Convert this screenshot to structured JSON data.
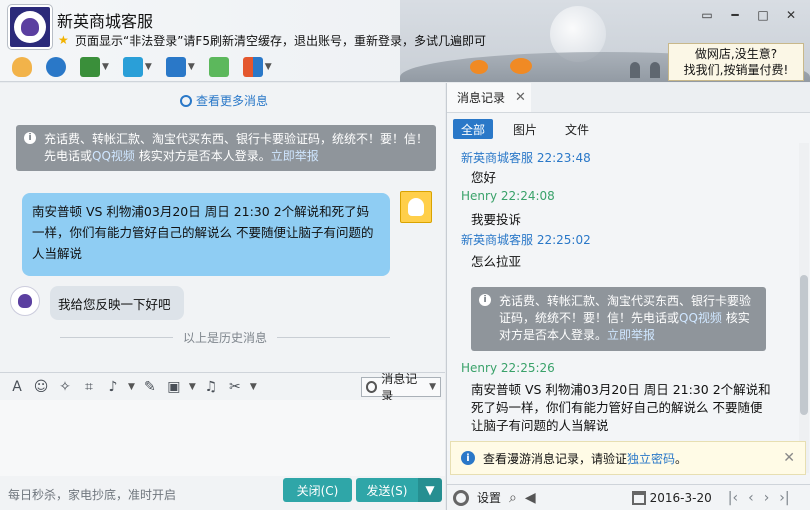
{
  "window": {
    "title": "新英商城客服",
    "notice": "页面显示“非法登录”请F5刷新清空缓存，退出账号，重新登录，多试几遍即可",
    "ad_line1": "做网店,没生意?",
    "ad_line2": "找我们,按销量付费!",
    "avatar_text": "PREMIER LEAGUE",
    "controls": [
      "━",
      "□",
      "✕",
      "▭"
    ]
  },
  "toolbar": {
    "icons": [
      "microphone-icon",
      "webcam-icon",
      "presentation-icon",
      "file-transfer-icon",
      "remote-desktop-icon",
      "add-app-icon",
      "apps-grid-icon"
    ]
  },
  "chat": {
    "view_more": "查看更多消息",
    "system_msg": "充话费、转帐汇款、淘宝代买东西、银行卡要验证码，统统不！要！信！先电话或",
    "system_msg_link1": "QQ视频",
    "system_msg_tail": "核实对方是否本人登录。",
    "system_msg_link2": "立即举报",
    "bubble_outgoing": "南安普顿 VS 利物浦03月20日 周日 21:30 2个解说和死了妈一样，你们有能力管好自己的解说么 不要随便让脑子有问题的人当解说",
    "bubble_incoming": "我给您反映一下好吧",
    "history_divider": "以上是历史消息",
    "footer_text": "每日秒杀，家电抄底，准时开启",
    "close_label": "关闭(C)",
    "send_label": "发送(S)",
    "history_button": "消息记录"
  },
  "history": {
    "tab_label": "消息记录",
    "filters": [
      "全部",
      "图片",
      "文件"
    ],
    "entries": [
      {
        "sender": "新英商城客服",
        "time": "22:23:48",
        "text": "您好"
      },
      {
        "sender": "Henry",
        "time": "22:24:08",
        "text": "我要投诉"
      },
      {
        "sender": "新英商城客服",
        "time": "22:25:02",
        "text": "怎么拉亚"
      },
      {
        "sender": "Henry",
        "time": "22:25:26",
        "text": "南安普顿 VS 利物浦03月20日 周日 21:30 2个解说和死了妈一样，你们有能力管好自己的解说么 不要随便让脑子有问题的人当解说"
      }
    ],
    "system_msg": "充话费、转帐汇款、淘宝代买东西、银行卡要验证码，统统不！要！信！先电话或",
    "system_msg_link1": "QQ视频",
    "system_msg_tail": "核实对方是否本人登录。",
    "system_msg_link2": "立即举报",
    "toast_text": "查看漫游消息记录，请验证",
    "toast_link": "独立密码",
    "toast_end": "。",
    "settings_label": "设置",
    "date": "2016-3-20"
  }
}
